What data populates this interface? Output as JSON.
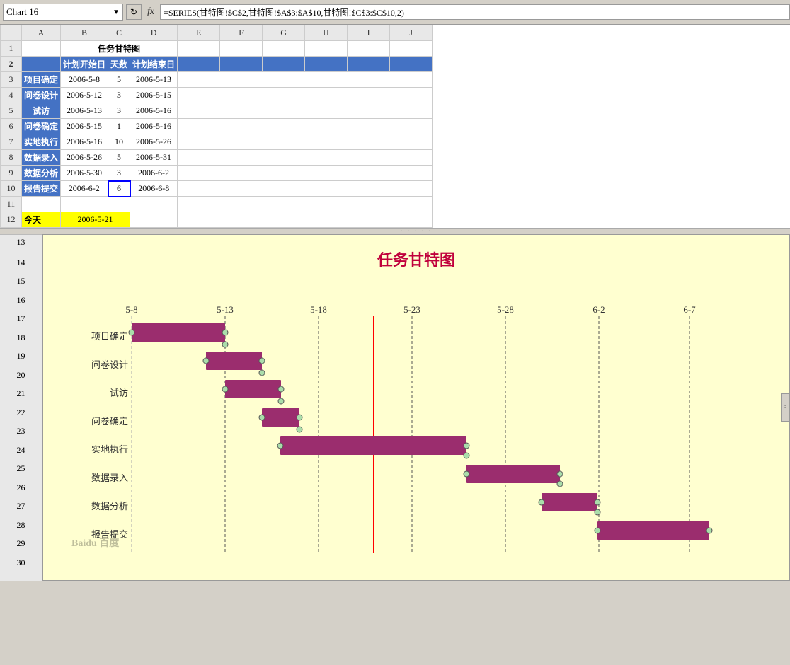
{
  "topbar": {
    "chart_name": "Chart 16",
    "dropdown_arrow": "▼",
    "refresh_icon": "↻",
    "fx_label": "fx",
    "formula": "=SERIES(甘特图!$C$2,甘特图!$A$3:$A$10,甘特图!$C$3:$C$10,2)"
  },
  "columns": [
    "A",
    "B",
    "C",
    "D",
    "E",
    "F",
    "G",
    "H",
    "I",
    "J"
  ],
  "row_numbers": [
    "1",
    "2",
    "3",
    "4",
    "5",
    "6",
    "7",
    "8",
    "9",
    "10",
    "11",
    "12"
  ],
  "title": "任务甘特图",
  "headers": {
    "col_a": "",
    "col_b": "计划开始日",
    "col_c": "天数",
    "col_d": "计划结束日"
  },
  "tasks": [
    {
      "name": "项目确定",
      "start": "2006-5-8",
      "days": "5",
      "end": "2006-5-13"
    },
    {
      "name": "问卷设计",
      "start": "2006-5-12",
      "days": "3",
      "end": "2006-5-15"
    },
    {
      "name": "试访",
      "start": "2006-5-13",
      "days": "3",
      "end": "2006-5-16"
    },
    {
      "name": "问卷确定",
      "start": "2006-5-15",
      "days": "1",
      "end": "2006-5-16"
    },
    {
      "name": "实地执行",
      "start": "2006-5-16",
      "days": "10",
      "end": "2006-5-26"
    },
    {
      "name": "数据录入",
      "start": "2006-5-26",
      "days": "5",
      "end": "2006-5-31"
    },
    {
      "name": "数据分析",
      "start": "2006-5-30",
      "days": "3",
      "end": "2006-6-2"
    },
    {
      "name": "报告提交",
      "start": "2006-6-2",
      "days": "6",
      "end": "2006-6-8"
    }
  ],
  "today": {
    "label": "今天",
    "value": "2006-5-21"
  },
  "chart": {
    "title": "任务甘特图",
    "date_labels": [
      "5-8",
      "5-13",
      "5-18",
      "5-23",
      "5-28",
      "6-2",
      "6-7"
    ],
    "task_names": [
      "项目确定",
      "问卷设计",
      "试访",
      "问卷确定",
      "实地执行",
      "数据录入",
      "数据分析",
      "报告提交"
    ],
    "watermark": "Baidu 百度"
  }
}
